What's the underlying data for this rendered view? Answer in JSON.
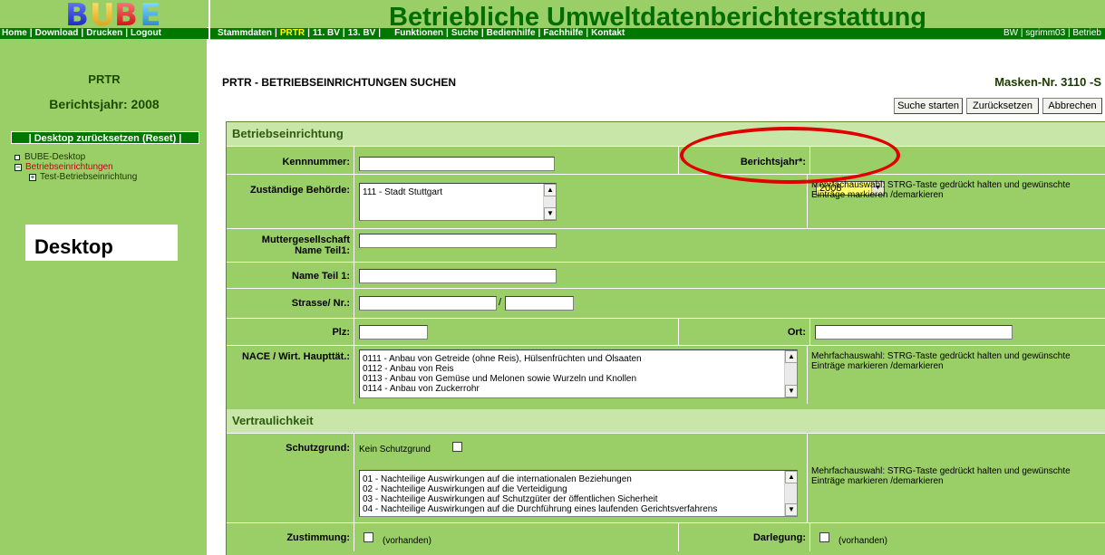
{
  "logo": {
    "letters": [
      "B",
      "U",
      "B",
      "E"
    ]
  },
  "left_nav": [
    "Home",
    "Download",
    "Drucken",
    "Logout"
  ],
  "header": {
    "title": "Betriebliche Umweltdatenberichterstattung",
    "nav": [
      "Stammdaten",
      "PRTR",
      "11. BV",
      "13. BV",
      "Funktionen",
      "Suche",
      "Bedienhilfe",
      "Fachhilfe",
      "Kontakt"
    ],
    "active_nav": "PRTR",
    "user_info": "BW | sgrimm03 | Betrieb"
  },
  "sidebar": {
    "module": "PRTR",
    "year": "Berichtsjahr: 2008",
    "reset_label": "| Desktop zurücksetzen (Reset) |",
    "tree": [
      {
        "label": "BUBE-Desktop"
      },
      {
        "label": "Betriebseinrichtungen"
      },
      {
        "label": "Test-Betriebseinrichtung"
      }
    ],
    "desktop_label": "Desktop"
  },
  "main": {
    "heading": "PRTR - BETRIEBSEINRICHTUNGEN SUCHEN",
    "mask_nr": "Masken-Nr. 3110 -S",
    "buttons": {
      "search": "Suche starten",
      "reset": "Zurücksetzen",
      "cancel": "Abbrechen"
    }
  },
  "form": {
    "section1": "Betriebseinrichtung",
    "kennnummer_label": "Kennnummer:",
    "berichtsjahr_label": "Berichtsjahr*:",
    "berichtsjahr_value": "2008",
    "behoerde_label": "Zuständige Behörde:",
    "behoerde_options": [
      "111 - Stadt Stuttgart"
    ],
    "multi_hint": "Mehrfachauswahl: STRG-Taste gedrückt halten und gewünschte Einträge markieren /demarkieren",
    "mutter_label_1": "Muttergesellschaft",
    "mutter_label_2": "Name Teil1:",
    "name1_label": "Name Teil 1:",
    "strasse_label": "Strasse/ Nr.:",
    "strasse_sep": "/",
    "plz_label": "Plz:",
    "ort_label": "Ort:",
    "nace_label": "NACE / Wirt. Haupttät.:",
    "nace_options": [
      "0111 - Anbau von Getreide (ohne Reis), Hülsenfrüchten und Ölsaaten",
      "0112 - Anbau von Reis",
      "0113 - Anbau von Gemüse und Melonen sowie Wurzeln und Knollen",
      "0114 - Anbau von Zuckerrohr"
    ],
    "section2": "Vertraulichkeit",
    "schutz_label": "Schutzgrund:",
    "kein_schutz": "Kein Schutzgrund",
    "schutz_options": [
      "01 - Nachteilige Auswirkungen auf die internationalen Beziehungen",
      "02 - Nachteilige Auswirkungen auf die Verteidigung",
      "03 - Nachteilige Auswirkungen auf Schutzgüter der öffentlichen Sicherheit",
      "04 - Nachteilige Auswirkungen auf die Durchführung eines laufenden Gerichtsverfahrens"
    ],
    "zustimmung_label": "Zustimmung:",
    "darlegung_label": "Darlegung:",
    "vorhanden": "(vorhanden)"
  },
  "colors": {
    "sidebar_green": "#9acf67",
    "nav_green": "#007800",
    "title_green": "#006e00",
    "section_green": "#c8e6a8",
    "annotation_red": "#e00000",
    "highlight_yellow": "#ffff66"
  }
}
